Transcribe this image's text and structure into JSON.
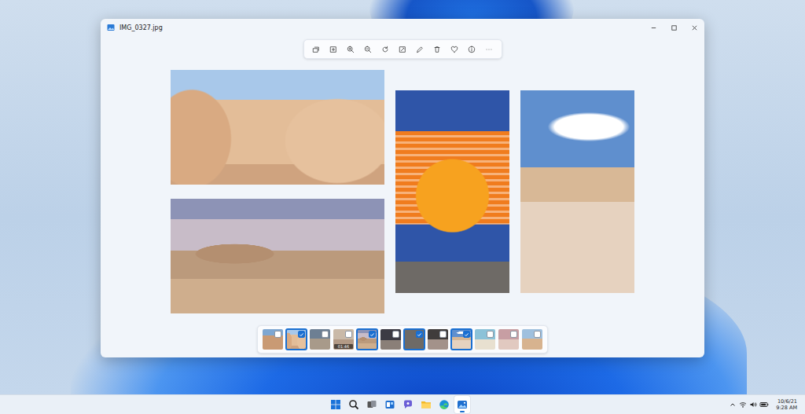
{
  "window": {
    "title": "IMG_0327.jpg"
  },
  "filmstrip": [
    {
      "kind": "photo",
      "selected": false
    },
    {
      "kind": "photo",
      "selected": true
    },
    {
      "kind": "photo",
      "selected": false
    },
    {
      "kind": "video",
      "selected": false,
      "duration": "01:46"
    },
    {
      "kind": "photo",
      "selected": true
    },
    {
      "kind": "photo",
      "selected": false
    },
    {
      "kind": "photo",
      "selected": true
    },
    {
      "kind": "photo",
      "selected": false
    },
    {
      "kind": "photo",
      "selected": true
    },
    {
      "kind": "photo",
      "selected": false
    },
    {
      "kind": "photo",
      "selected": false
    },
    {
      "kind": "photo",
      "selected": false
    }
  ],
  "taskbar": {
    "apps": [
      {
        "name": "start",
        "active": false
      },
      {
        "name": "search",
        "active": false
      },
      {
        "name": "task-view",
        "active": false
      },
      {
        "name": "widgets",
        "active": false
      },
      {
        "name": "chat",
        "active": false
      },
      {
        "name": "file-explorer",
        "active": false
      },
      {
        "name": "edge",
        "active": false
      },
      {
        "name": "photos",
        "active": true
      }
    ]
  },
  "clock": {
    "time": "9:28 AM",
    "date": "10/6/21"
  }
}
